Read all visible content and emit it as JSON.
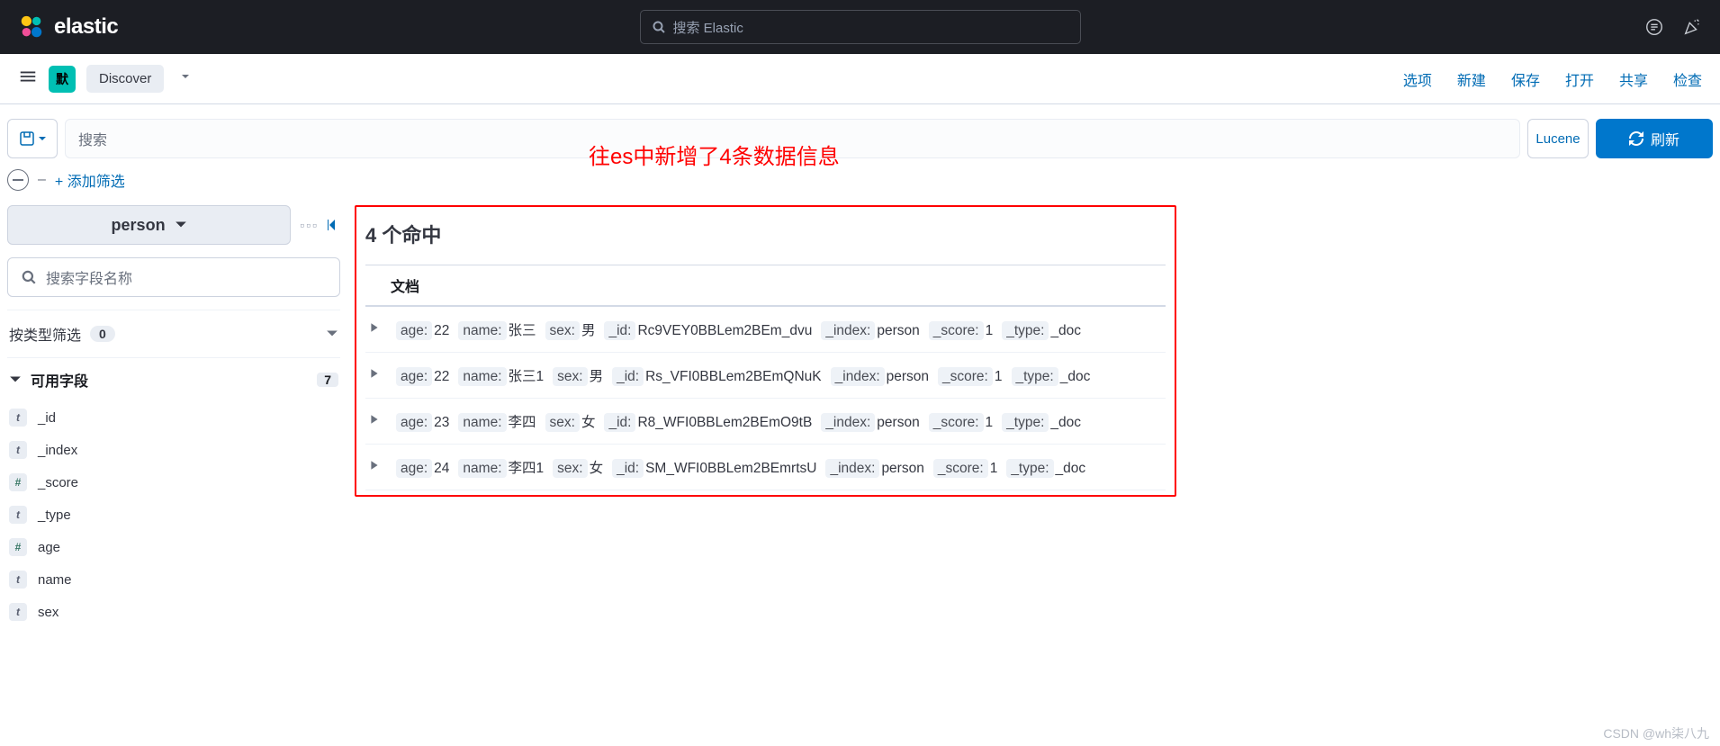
{
  "top_header": {
    "brand": "elastic",
    "search_placeholder": "搜索 Elastic"
  },
  "app_nav": {
    "space_badge": "默",
    "app_name": "Discover",
    "links": [
      "选项",
      "新建",
      "保存",
      "打开",
      "共享",
      "检查"
    ]
  },
  "query_bar": {
    "search_placeholder": "搜索",
    "lang_label": "Lucene",
    "refresh_label": "刷新"
  },
  "filter_bar": {
    "add_filter": "+ 添加筛选"
  },
  "sidebar": {
    "index_pattern": "person",
    "field_search_placeholder": "搜索字段名称",
    "filter_by_type": "按类型筛选",
    "filter_count": "0",
    "available_fields_label": "可用字段",
    "available_count": "7",
    "fields": [
      {
        "type": "t",
        "name": "_id"
      },
      {
        "type": "t",
        "name": "_index"
      },
      {
        "type": "#",
        "name": "_score"
      },
      {
        "type": "t",
        "name": "_type"
      },
      {
        "type": "#",
        "name": "age"
      },
      {
        "type": "t",
        "name": "name"
      },
      {
        "type": "t",
        "name": "sex"
      }
    ]
  },
  "content": {
    "annotation_text": "往es中新增了4条数据信息",
    "hit_count_prefix": "4",
    "hit_count_suffix": " 个命中",
    "doc_header": "文档",
    "docs": [
      {
        "age": "22",
        "name": "张三",
        "sex": "男",
        "_id": "Rc9VEY0BBLem2BEm_dvu",
        "_index": "person",
        "_score": "1",
        "_type": "_doc"
      },
      {
        "age": "22",
        "name": "张三1",
        "sex": "男",
        "_id": "Rs_VFI0BBLem2BEmQNuK",
        "_index": "person",
        "_score": "1",
        "_type": "_doc"
      },
      {
        "age": "23",
        "name": "李四",
        "sex": "女",
        "_id": "R8_WFI0BBLem2BEmO9tB",
        "_index": "person",
        "_score": "1",
        "_type": "_doc"
      },
      {
        "age": "24",
        "name": "李四1",
        "sex": "女",
        "_id": "SM_WFI0BBLem2BEmrtsU",
        "_index": "person",
        "_score": "1",
        "_type": "_doc"
      }
    ]
  },
  "watermark": "CSDN @wh柒八九"
}
